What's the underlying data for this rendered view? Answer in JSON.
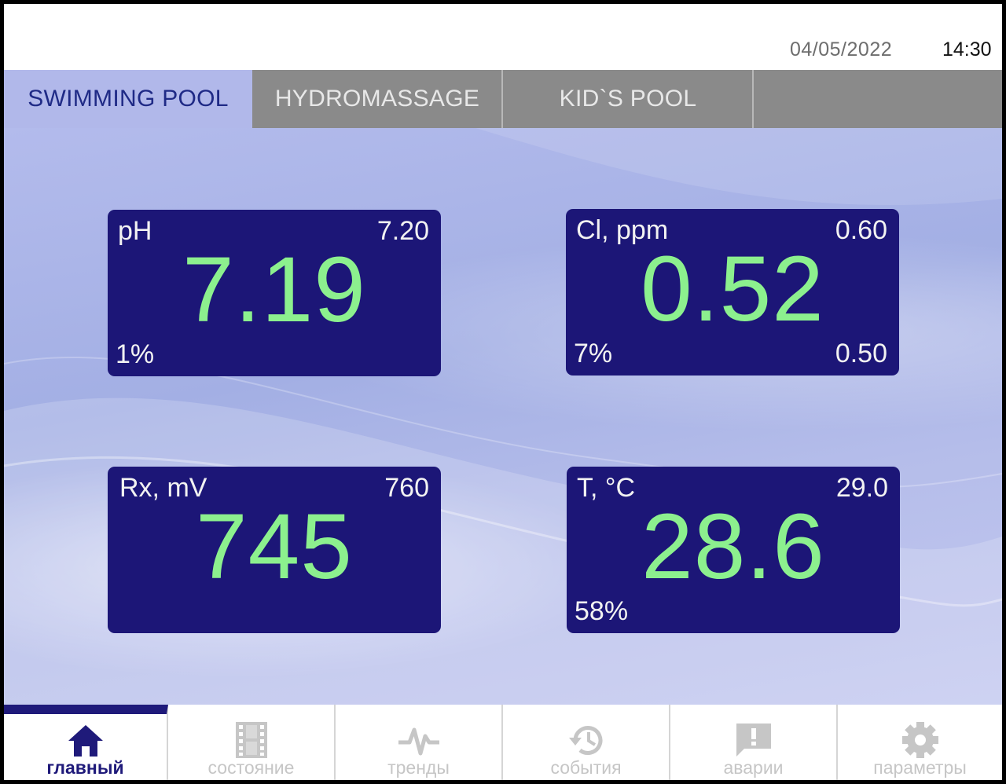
{
  "header": {
    "date": "04/05/2022",
    "time": "14:30"
  },
  "tabs": [
    {
      "label": "SWIMMING POOL",
      "active": true
    },
    {
      "label": "HYDROMASSAGE",
      "active": false
    },
    {
      "label": "KID`S POOL",
      "active": false
    }
  ],
  "panels": {
    "ph": {
      "label": "pH",
      "setpoint": "7.20",
      "value": "7.19",
      "percent": "1%",
      "low": ""
    },
    "cl": {
      "label": "Cl, ppm",
      "setpoint": "0.60",
      "value": "0.52",
      "percent": "7%",
      "low": "0.50"
    },
    "rx": {
      "label": "Rx, mV",
      "setpoint": "760",
      "value": "745",
      "percent": "",
      "low": ""
    },
    "temp": {
      "label": "T, °C",
      "setpoint": "29.0",
      "value": "28.6",
      "percent": "58%",
      "low": ""
    }
  },
  "colors": {
    "panel_bg": "#1c1677",
    "value_green": "#8cf08e",
    "accent": "#1f1a7a"
  },
  "nav": [
    {
      "label": "главный",
      "icon": "home-icon",
      "active": true
    },
    {
      "label": "состояние",
      "icon": "film-icon",
      "active": false
    },
    {
      "label": "тренды",
      "icon": "pulse-icon",
      "active": false
    },
    {
      "label": "события",
      "icon": "history-icon",
      "active": false
    },
    {
      "label": "аварии",
      "icon": "alert-message-icon",
      "active": false
    },
    {
      "label": "параметры",
      "icon": "gear-icon",
      "active": false
    }
  ]
}
